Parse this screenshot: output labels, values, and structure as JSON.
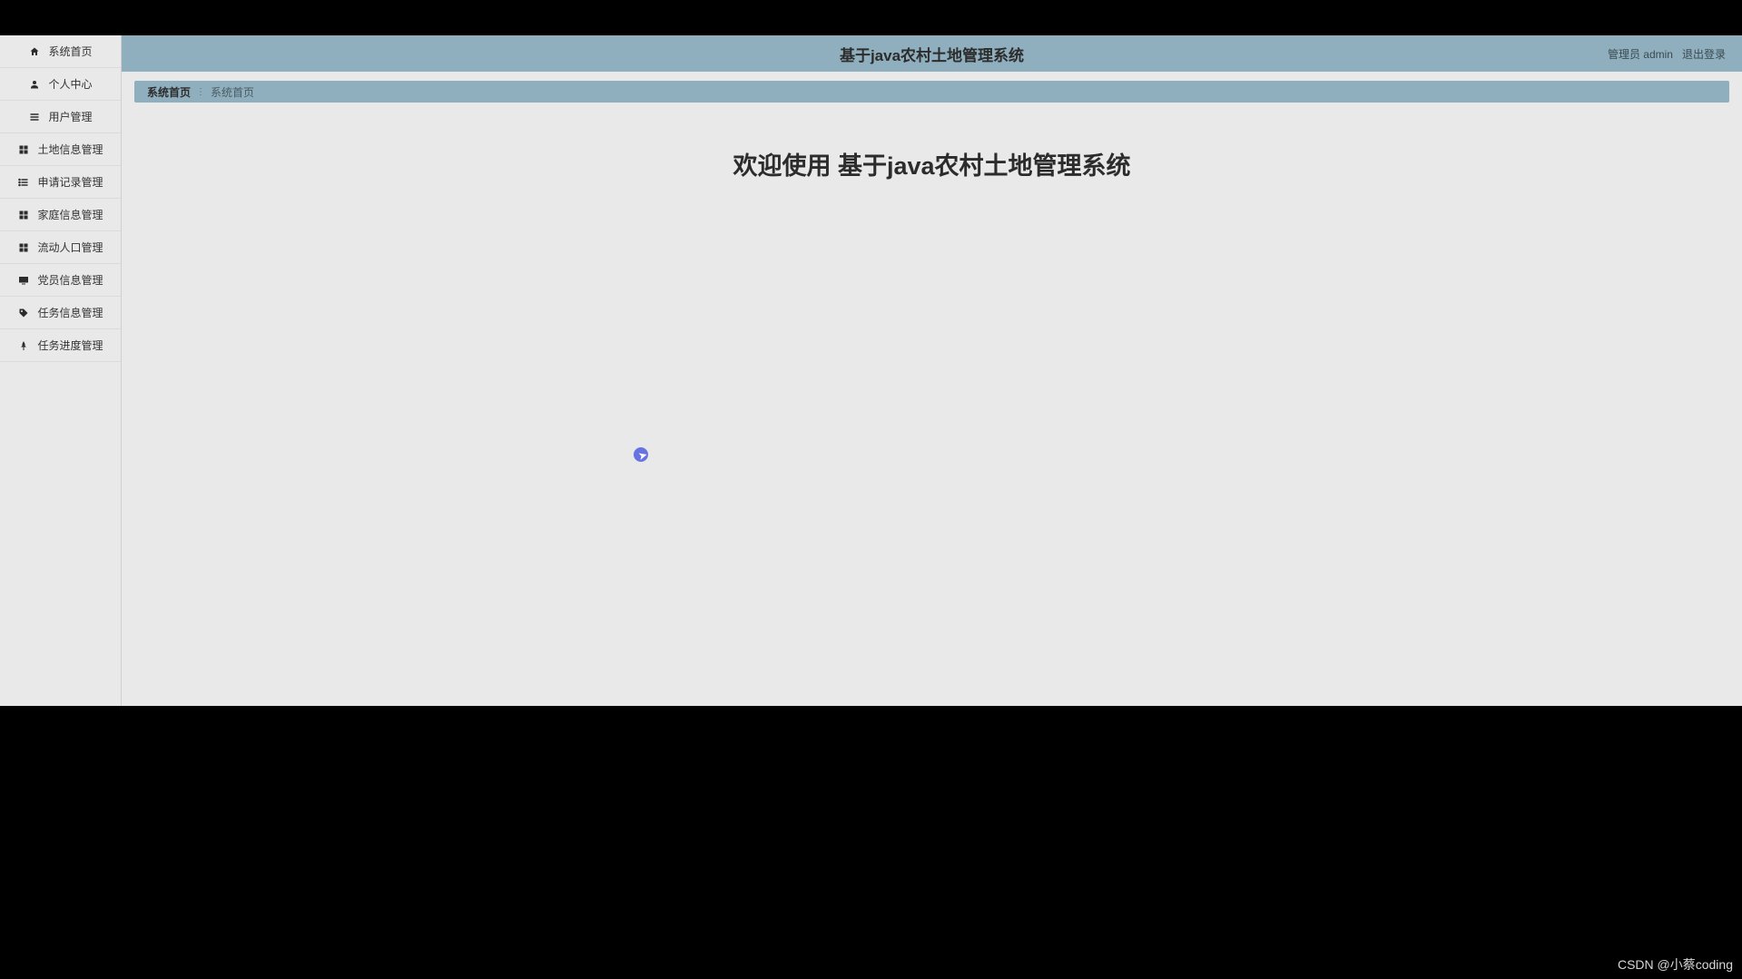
{
  "header": {
    "title": "基于java农村土地管理系统",
    "user_label": "管理员 admin",
    "logout_label": "退出登录"
  },
  "sidebar": {
    "items": [
      {
        "icon": "home",
        "label": "系统首页"
      },
      {
        "icon": "person",
        "label": "个人中心"
      },
      {
        "icon": "menu",
        "label": "用户管理"
      },
      {
        "icon": "grid",
        "label": "土地信息管理"
      },
      {
        "icon": "list",
        "label": "申请记录管理"
      },
      {
        "icon": "grid",
        "label": "家庭信息管理"
      },
      {
        "icon": "grid",
        "label": "流动人口管理"
      },
      {
        "icon": "monitor",
        "label": "党员信息管理"
      },
      {
        "icon": "tag",
        "label": "任务信息管理"
      },
      {
        "icon": "pin",
        "label": "任务进度管理"
      }
    ]
  },
  "breadcrumb": {
    "root": "系统首页",
    "sep": "⋮",
    "current": "系统首页"
  },
  "main": {
    "welcome": "欢迎使用 基于java农村土地管理系统"
  },
  "watermark": "CSDN @小蔡coding"
}
